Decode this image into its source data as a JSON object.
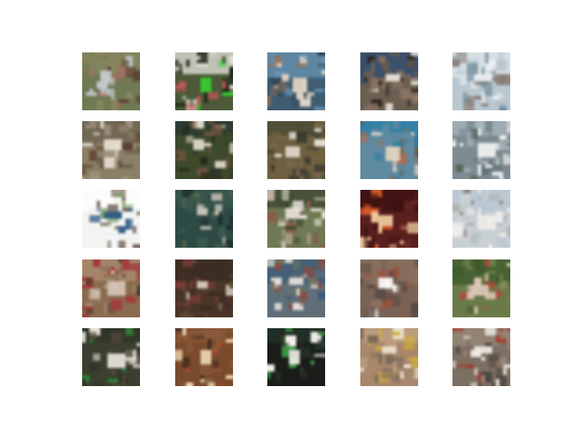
{
  "figure": {
    "background": "#ffffff",
    "rows": 5,
    "cols": 5,
    "tiles": [
      {
        "row": 0,
        "col": 0,
        "bg": "#6f7a55",
        "top": "#8a8760",
        "accent": "#c8cfd6",
        "blob": "#b56a63",
        "blob2": "#5b3d34"
      },
      {
        "row": 0,
        "col": 1,
        "bg": "#4d5a3a",
        "top": "#e7e5df",
        "accent": "#35d12c",
        "blob": "#c45757",
        "blob2": "#1f2519"
      },
      {
        "row": 0,
        "col": 2,
        "bg": "#3f5c71",
        "top": "#6a93b2",
        "accent": "#e7d9c9",
        "blob": "#8e735b",
        "blob2": "#263640"
      },
      {
        "row": 0,
        "col": 3,
        "bg": "#6c5f51",
        "top": "#2e4b73",
        "accent": "#ede9e3",
        "blob": "#8b7462",
        "blob2": "#2a2320"
      },
      {
        "row": 0,
        "col": 4,
        "bg": "#b9c7d0",
        "top": "#dfe6ea",
        "accent": "#f0f2f3",
        "blob": "#8a7e76",
        "blob2": "#6f8a99"
      },
      {
        "row": 1,
        "col": 0,
        "bg": "#8b7f67",
        "top": "#6b604f",
        "accent": "#ebe3d7",
        "blob": "#5a3c2f",
        "blob2": "#a69883"
      },
      {
        "row": 1,
        "col": 1,
        "bg": "#3e4a2c",
        "top": "#2a3a35",
        "accent": "#e8dfd0",
        "blob": "#7b5840",
        "blob2": "#23281a"
      },
      {
        "row": 1,
        "col": 2,
        "bg": "#6e6040",
        "top": "#4a4a36",
        "accent": "#e3dcd2",
        "blob": "#7c6a55",
        "blob2": "#3b3a2e"
      },
      {
        "row": 1,
        "col": 3,
        "bg": "#5f8aa0",
        "top": "#2a7ea8",
        "accent": "#e6d7c4",
        "blob": "#b06b4e",
        "blob2": "#5e5e40"
      },
      {
        "row": 1,
        "col": 4,
        "bg": "#7e8b91",
        "top": "#a8b6bd",
        "accent": "#f3f4f4",
        "blob": "#607079",
        "blob2": "#4c5b45"
      },
      {
        "row": 2,
        "col": 0,
        "bg": "#f3f3f2",
        "top": "#ffffff",
        "accent": "#2f5a86",
        "blob": "#7a9d62",
        "blob2": "#6d5c50"
      },
      {
        "row": 2,
        "col": 1,
        "bg": "#2e4a45",
        "top": "#3b5a4f",
        "accent": "#d8cfc3",
        "blob": "#1f2d30",
        "blob2": "#5a6a4e"
      },
      {
        "row": 2,
        "col": 2,
        "bg": "#6e7a55",
        "top": "#3c4530",
        "accent": "#eae3da",
        "blob": "#8a5c4c",
        "blob2": "#a39b85"
      },
      {
        "row": 2,
        "col": 3,
        "bg": "#5a1f1f",
        "top": "#3d1212",
        "accent": "#f4d2a2",
        "blob": "#e05f2e",
        "blob2": "#6d2a2a"
      },
      {
        "row": 2,
        "col": 4,
        "bg": "#c9d0d4",
        "top": "#b7c6d2",
        "accent": "#f1f0ec",
        "blob": "#8c7f73",
        "blob2": "#aeb4b3"
      },
      {
        "row": 3,
        "col": 0,
        "bg": "#8a6c4f",
        "top": "#ac8d71",
        "accent": "#d6c6b8",
        "blob": "#a3393a",
        "blob2": "#4e3a2f"
      },
      {
        "row": 3,
        "col": 1,
        "bg": "#4a3628",
        "top": "#3a2c22",
        "accent": "#dfd3c5",
        "blob": "#7a3c36",
        "blob2": "#5b4a3a"
      },
      {
        "row": 3,
        "col": 2,
        "bg": "#5e6f7a",
        "top": "#3d5b78",
        "accent": "#ece6de",
        "blob": "#8b4b40",
        "blob2": "#6e7460"
      },
      {
        "row": 3,
        "col": 3,
        "bg": "#7a6356",
        "top": "#8e7060",
        "accent": "#ffffff",
        "blob": "#a0513c",
        "blob2": "#5a4b43"
      },
      {
        "row": 3,
        "col": 4,
        "bg": "#6b7b48",
        "top": "#3e5a2d",
        "accent": "#e2c9bb",
        "blob": "#c1403a",
        "blob2": "#73814a"
      },
      {
        "row": 4,
        "col": 0,
        "bg": "#3c3f2f",
        "top": "#2d3527",
        "accent": "#eeeae3",
        "blob": "#2e8a3a",
        "blob2": "#5d4a3c"
      },
      {
        "row": 4,
        "col": 1,
        "bg": "#7a4a2c",
        "top": "#8a5a3a",
        "accent": "#f0d9b5",
        "blob": "#c04b2e",
        "blob2": "#3a2a1e"
      },
      {
        "row": 4,
        "col": 2,
        "bg": "#1a1d1a",
        "top": "#23352a",
        "accent": "#f3efe7",
        "blob": "#3ea04a",
        "blob2": "#2c2a24"
      },
      {
        "row": 4,
        "col": 3,
        "bg": "#a8876b",
        "top": "#c2a384",
        "accent": "#ede4d6",
        "blob": "#d0b03c",
        "blob2": "#7c6a5a"
      },
      {
        "row": 4,
        "col": 4,
        "bg": "#7d6f62",
        "top": "#9a8a7c",
        "accent": "#f2eee8",
        "blob": "#a5382f",
        "blob2": "#4e4a40"
      }
    ]
  }
}
